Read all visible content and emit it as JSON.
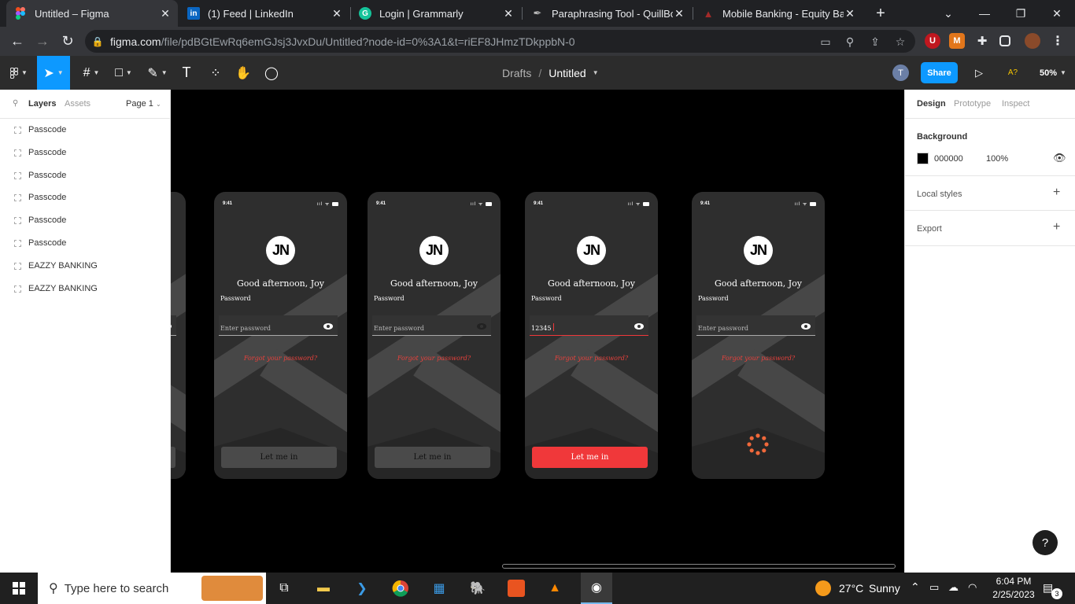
{
  "browser": {
    "tabs": [
      {
        "title": "Untitled – Figma",
        "icon": "figma-icon",
        "active": true
      },
      {
        "title": "(1) Feed | LinkedIn",
        "icon": "linkedin-icon",
        "active": false
      },
      {
        "title": "Login | Grammarly",
        "icon": "grammarly-icon",
        "active": false
      },
      {
        "title": "Paraphrasing Tool - QuillBot",
        "icon": "quillbot-icon",
        "active": false
      },
      {
        "title": "Mobile Banking - Equity Bank",
        "icon": "equity-icon",
        "active": false
      }
    ],
    "new_tab": "+",
    "url_host": "figma.com",
    "url_rest": "/file/pdBGtEwRq6emGJsj3JvxDu/Untitled?node-id=0%3A1&t=riEF8JHmzTDkppbN-0",
    "extensions": [
      "U",
      "M"
    ]
  },
  "figma": {
    "breadcrumb_root": "Drafts",
    "breadcrumb_sep": "/",
    "file_name": "Untitled",
    "user_initial": "T",
    "share_label": "Share",
    "a11y_label": "A?",
    "zoom": "50%",
    "left_panel": {
      "tab_layers": "Layers",
      "tab_assets": "Assets",
      "page": "Page 1",
      "layers": [
        "Passcode",
        "Passcode",
        "Passcode",
        "Passcode",
        "Passcode",
        "Passcode",
        "EAZZY BANKING",
        "EAZZY BANKING"
      ]
    },
    "right_panel": {
      "tab_design": "Design",
      "tab_prototype": "Prototype",
      "tab_inspect": "Inspect",
      "background_label": "Background",
      "bg_hex": "000000",
      "bg_opacity": "100%",
      "local_styles": "Local styles",
      "export": "Export",
      "plus": "+"
    },
    "help": "?"
  },
  "screens": {
    "time": "9:41",
    "logo": "JN",
    "greeting": "Good afternoon, Joy",
    "password_label": "Password",
    "placeholder": "Enter password",
    "typed_value": "12345",
    "forgot": "Forgot your password?",
    "cta": "Let me in",
    "accent": "#f0383a"
  },
  "taskbar": {
    "search_placeholder": "Type here to search",
    "weather_temp": "27°C",
    "weather_desc": "Sunny",
    "time": "6:04 PM",
    "date": "2/25/2023",
    "notif_count": "3"
  }
}
